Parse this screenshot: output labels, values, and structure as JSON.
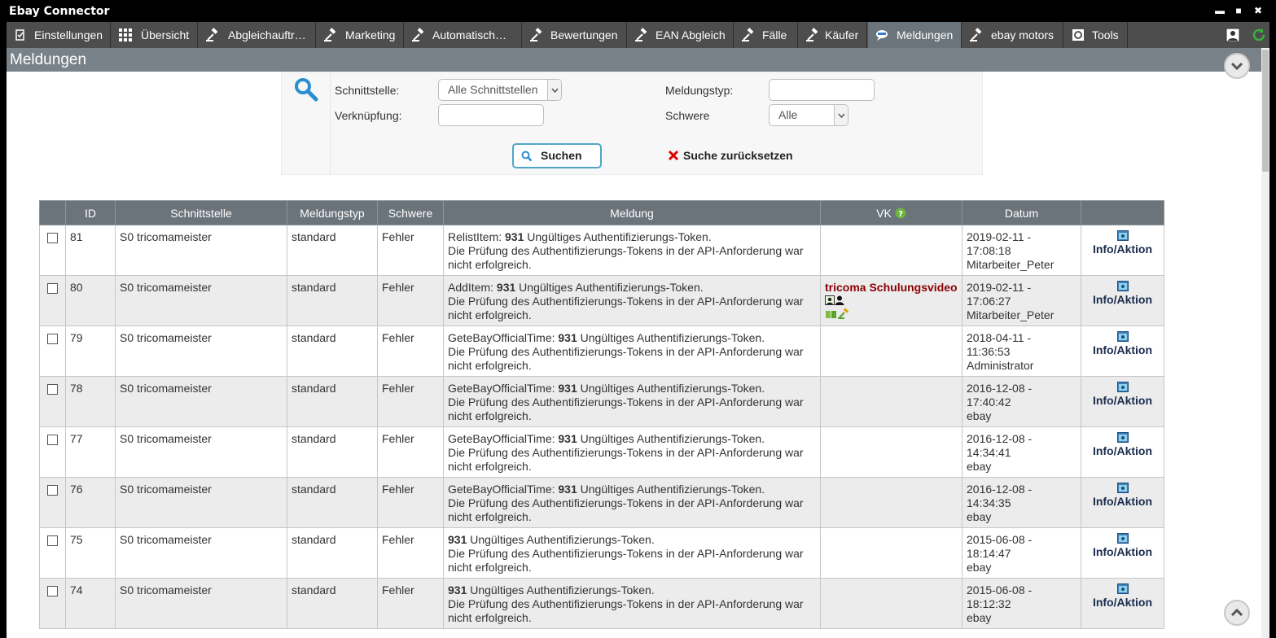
{
  "window": {
    "title": "Ebay Connector",
    "controls": {
      "minimize": "▬",
      "maximize": "■",
      "close": "✖"
    }
  },
  "tabs": [
    {
      "label": "Einstellungen",
      "icon": "clipboard-check-icon"
    },
    {
      "label": "Übersicht",
      "icon": "grid-icon"
    },
    {
      "label": "Abgleichauftr…",
      "icon": "gavel-icon"
    },
    {
      "label": "Marketing",
      "icon": "gavel-icon"
    },
    {
      "label": "Automatisch…",
      "icon": "gavel-icon"
    },
    {
      "label": "Bewertungen",
      "icon": "gavel-icon"
    },
    {
      "label": "EAN Abgleich",
      "icon": "gavel-icon"
    },
    {
      "label": "Fälle",
      "icon": "gavel-icon"
    },
    {
      "label": "Käufer",
      "icon": "gavel-icon"
    },
    {
      "label": "Meldungen",
      "icon": "chat-icon",
      "active": true
    },
    {
      "label": "ebay motors",
      "icon": "gavel-icon"
    },
    {
      "label": "Tools",
      "icon": "tools-icon"
    }
  ],
  "page": {
    "title": "Meldungen"
  },
  "search": {
    "schnittstelle_label": "Schnittstelle:",
    "schnittstelle_value": "Alle Schnittstellen",
    "verknuepfung_label": "Verknüpfung:",
    "verknuepfung_value": "",
    "meldungstyp_label": "Meldungstyp:",
    "meldungstyp_value": "",
    "schwere_label": "Schwere",
    "schwere_value": "Alle",
    "search_button": "Suchen",
    "reset_link": "Suche zurücksetzen"
  },
  "table": {
    "headers": [
      "",
      "ID",
      "Schnittstelle",
      "Meldungstyp",
      "Schwere",
      "Meldung",
      "VK",
      "Datum",
      ""
    ],
    "rows": [
      {
        "id": "81",
        "schnittstelle": "S0 tricomameister",
        "typ": "standard",
        "schwere": "Fehler",
        "prefix": "RelistItem: ",
        "code": "931",
        "msg1": " Ungültiges Authentifizierungs-Token.",
        "msg2": "Die Prüfung des Authentifizierungs-Tokens in der API-Anforderung war nicht erfolgreich.",
        "vk": "",
        "date": "2019-02-11 -",
        "time": "17:08:18",
        "user": "Mitarbeiter_Peter",
        "action": "Info/Aktion"
      },
      {
        "id": "80",
        "schnittstelle": "S0 tricomameister",
        "typ": "standard",
        "schwere": "Fehler",
        "prefix": "AddItem: ",
        "code": "931",
        "msg1": " Ungültiges Authentifizierungs-Token.",
        "msg2": "Die Prüfung des Authentifizierungs-Tokens in der API-Anforderung war nicht erfolgreich.",
        "vk": "tricoma Schulungsvideo",
        "date": "2019-02-11 -",
        "time": "17:06:27",
        "user": "Mitarbeiter_Peter",
        "action": "Info/Aktion"
      },
      {
        "id": "79",
        "schnittstelle": "S0 tricomameister",
        "typ": "standard",
        "schwere": "Fehler",
        "prefix": "GeteBayOfficialTime: ",
        "code": "931",
        "msg1": " Ungültiges Authentifizierungs-Token.",
        "msg2": "Die Prüfung des Authentifizierungs-Tokens in der API-Anforderung war nicht erfolgreich.",
        "vk": "",
        "date": "2018-04-11 -",
        "time": "11:36:53",
        "user": "Administrator",
        "action": "Info/Aktion"
      },
      {
        "id": "78",
        "schnittstelle": "S0 tricomameister",
        "typ": "standard",
        "schwere": "Fehler",
        "prefix": "GeteBayOfficialTime: ",
        "code": "931",
        "msg1": " Ungültiges Authentifizierungs-Token.",
        "msg2": "Die Prüfung des Authentifizierungs-Tokens in der API-Anforderung war nicht erfolgreich.",
        "vk": "",
        "date": "2016-12-08 -",
        "time": "17:40:42",
        "user": "ebay",
        "action": "Info/Aktion"
      },
      {
        "id": "77",
        "schnittstelle": "S0 tricomameister",
        "typ": "standard",
        "schwere": "Fehler",
        "prefix": "GeteBayOfficialTime: ",
        "code": "931",
        "msg1": " Ungültiges Authentifizierungs-Token.",
        "msg2": "Die Prüfung des Authentifizierungs-Tokens in der API-Anforderung war nicht erfolgreich.",
        "vk": "",
        "date": "2016-12-08 -",
        "time": "14:34:41",
        "user": "ebay",
        "action": "Info/Aktion"
      },
      {
        "id": "76",
        "schnittstelle": "S0 tricomameister",
        "typ": "standard",
        "schwere": "Fehler",
        "prefix": "GeteBayOfficialTime: ",
        "code": "931",
        "msg1": " Ungültiges Authentifizierungs-Token.",
        "msg2": "Die Prüfung des Authentifizierungs-Tokens in der API-Anforderung war nicht erfolgreich.",
        "vk": "",
        "date": "2016-12-08 -",
        "time": "14:34:35",
        "user": "ebay",
        "action": "Info/Aktion"
      },
      {
        "id": "75",
        "schnittstelle": "S0 tricomameister",
        "typ": "standard",
        "schwere": "Fehler",
        "prefix": "",
        "code": "931",
        "msg1": " Ungültiges Authentifizierungs-Token.",
        "msg2": "Die Prüfung des Authentifizierungs-Tokens in der API-Anforderung war nicht erfolgreich.",
        "vk": "",
        "date": "2015-06-08 -",
        "time": "18:14:47",
        "user": "ebay",
        "action": "Info/Aktion"
      },
      {
        "id": "74",
        "schnittstelle": "S0 tricomameister",
        "typ": "standard",
        "schwere": "Fehler",
        "prefix": "",
        "code": "931",
        "msg1": " Ungültiges Authentifizierungs-Token.",
        "msg2": "Die Prüfung des Authentifizierungs-Tokens in der API-Anforderung war nicht erfolgreich.",
        "vk": "",
        "date": "2015-06-08 -",
        "time": "18:12:32",
        "user": "ebay",
        "action": "Info/Aktion"
      }
    ]
  },
  "colors": {
    "tabbar": "#4d4d4d",
    "active_tab": "#6b737b",
    "header": "#7a8289",
    "error": "#d40000",
    "accent": "#4fa6c9"
  }
}
